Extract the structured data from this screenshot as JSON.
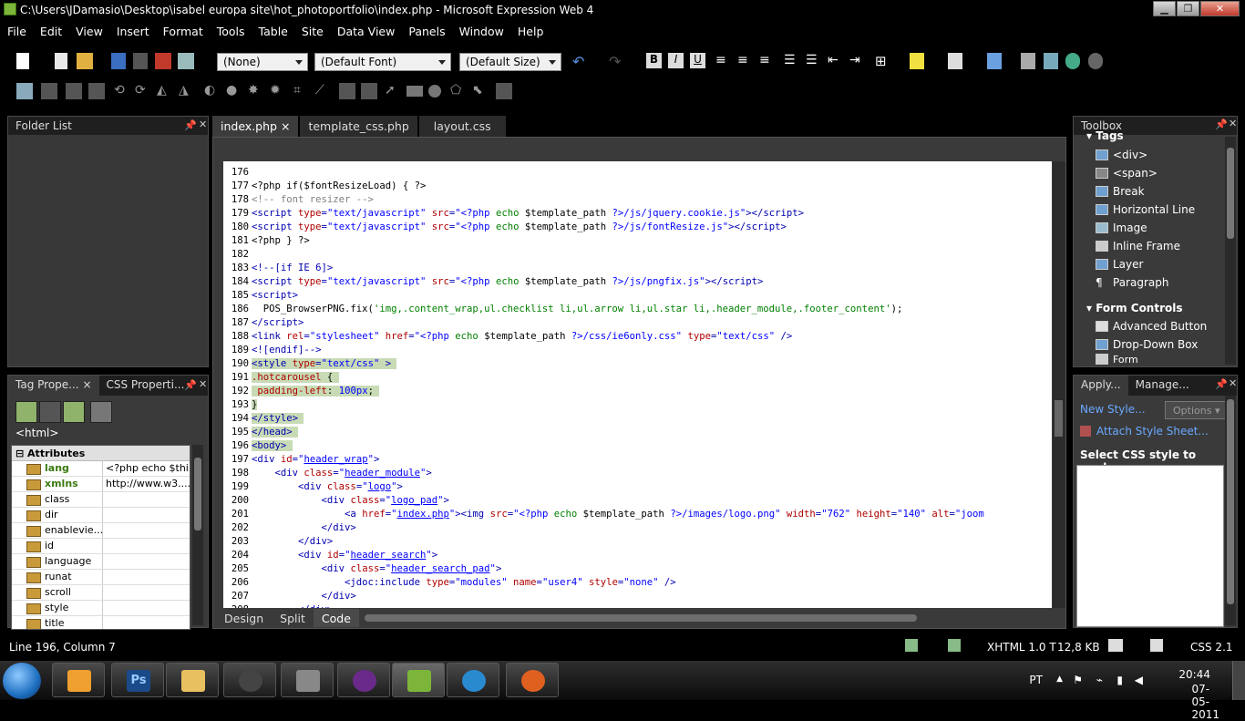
{
  "window": {
    "title": "C:\\Users\\JDamasio\\Desktop\\isabel europa site\\hot_photoportfolio\\index.php - Microsoft Expression Web 4"
  },
  "menu": [
    "File",
    "Edit",
    "View",
    "Insert",
    "Format",
    "Tools",
    "Table",
    "Site",
    "Data View",
    "Panels",
    "Window",
    "Help"
  ],
  "toolbar": {
    "style_dropdown": "(None)",
    "font_dropdown": "(Default Font)",
    "size_dropdown": "(Default Size)"
  },
  "folder_list": {
    "title": "Folder List"
  },
  "tag_panel": {
    "tabs": [
      "Tag Prope...",
      "CSS Properti..."
    ],
    "current_tag": "<html>",
    "attributes_header": "Attributes",
    "attributes": [
      {
        "name": "lang",
        "value": "<?php echo $thi...",
        "set": true
      },
      {
        "name": "xmlns",
        "value": "http://www.w3....",
        "set": true
      },
      {
        "name": "class",
        "value": ""
      },
      {
        "name": "dir",
        "value": ""
      },
      {
        "name": "enablevie...",
        "value": ""
      },
      {
        "name": "id",
        "value": ""
      },
      {
        "name": "language",
        "value": ""
      },
      {
        "name": "runat",
        "value": ""
      },
      {
        "name": "scroll",
        "value": ""
      },
      {
        "name": "style",
        "value": ""
      },
      {
        "name": "title",
        "value": ""
      }
    ]
  },
  "doc_tabs": [
    "index.php",
    "template_css.php",
    "layout.css"
  ],
  "view_tabs": [
    "Design",
    "Split",
    "Code"
  ],
  "toolbox": {
    "title": "Toolbox",
    "tags_section": "Tags",
    "tags": [
      "<div>",
      "<span>",
      "Break",
      "Horizontal Line",
      "Image",
      "Inline Frame",
      "Layer",
      "Paragraph"
    ],
    "form_section": "Form Controls",
    "forms": [
      "Advanced Button",
      "Drop-Down Box",
      "Form"
    ]
  },
  "apply_panel": {
    "tabs": [
      "Apply...",
      "Manage..."
    ],
    "new_style": "New Style...",
    "options": "Options",
    "attach": "Attach Style Sheet...",
    "select_label": "Select CSS style to apply:"
  },
  "status": {
    "position": "Line 196, Column 7",
    "doctype": "XHTML 1.0 T",
    "size": "12,8 KB",
    "css": "CSS 2.1"
  },
  "tray": {
    "lang": "PT",
    "time": "20:44",
    "date": "07-05-2011"
  }
}
